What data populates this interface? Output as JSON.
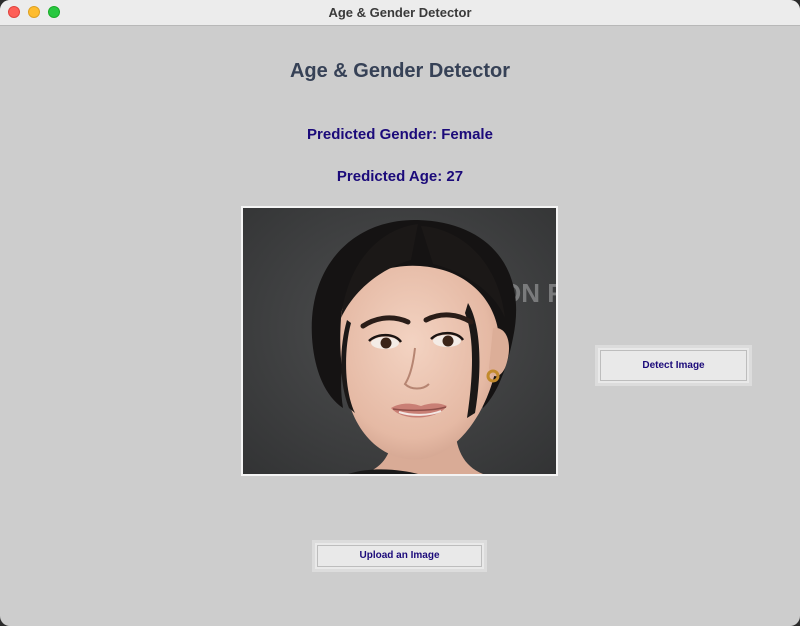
{
  "window": {
    "title": "Age & Gender Detector"
  },
  "main": {
    "heading": "Age & Gender Detector",
    "predicted_gender": "Predicted Gender: Female",
    "predicted_age": "Predicted Age: 27",
    "photo_backdrop_text": "ON R"
  },
  "buttons": {
    "detect_label": "Detect Image",
    "upload_label": "Upload an Image"
  },
  "colors": {
    "window_bg": "#cdcdcd",
    "heading": "#364156",
    "prediction_text": "#1b0a7a"
  }
}
